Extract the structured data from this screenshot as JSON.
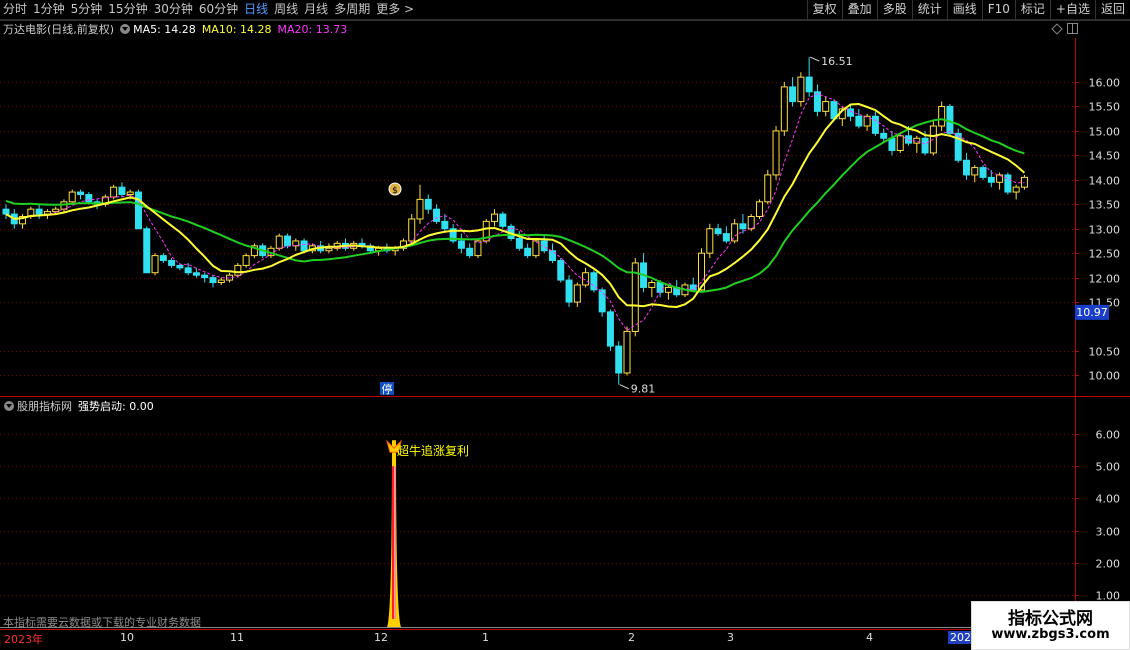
{
  "toolbar": {
    "periods": [
      {
        "label": "分时",
        "active": false
      },
      {
        "label": "1分钟",
        "active": false
      },
      {
        "label": "5分钟",
        "active": false
      },
      {
        "label": "15分钟",
        "active": false
      },
      {
        "label": "30分钟",
        "active": false
      },
      {
        "label": "60分钟",
        "active": false
      },
      {
        "label": "日线",
        "active": true
      },
      {
        "label": "周线",
        "active": false
      },
      {
        "label": "月线",
        "active": false
      },
      {
        "label": "多周期",
        "active": false
      },
      {
        "label": "更多 >",
        "active": false
      }
    ],
    "buttons": [
      "复权",
      "叠加",
      "多股",
      "统计",
      "画线",
      "F10",
      "标记",
      "+自选",
      "返回"
    ]
  },
  "main_chart": {
    "stock_title": "万达电影(日线,前复权)",
    "ma5": "MA5: 14.28",
    "ma10": "MA10: 14.28",
    "ma20": "MA20: 13.73",
    "max_label": "16.51",
    "min_label": "9.81",
    "current_price": "10.97",
    "limit_marker": "停",
    "money_icon_text": "$",
    "y_labels": [
      "16.00",
      "15.50",
      "15.00",
      "14.50",
      "14.00",
      "13.50",
      "13.00",
      "12.50",
      "12.00",
      "11.50",
      "10.50",
      "10.00"
    ]
  },
  "sub_chart": {
    "indicator_name": "股朋指标网",
    "indicator_line": "强势启动: 0.00",
    "signal_text": "超牛追涨复利",
    "y_labels": [
      "6.00",
      "5.00",
      "4.00",
      "3.00",
      "2.00",
      "1.00"
    ],
    "notice": "本指标需要云数据或下载的专业财务数据"
  },
  "date_axis": [
    "2023年",
    "10",
    "11",
    "12",
    "1",
    "2",
    "3",
    "4",
    "2024"
  ],
  "watermark": {
    "title": "指标公式网",
    "url": "www.zbgs3.com"
  },
  "colors": {
    "up": "#ffe040",
    "down": "#30e0f0",
    "ma_yellow": "#ffff33",
    "ma_green": "#20d020",
    "ma_magenta": "#ff33ff",
    "grid": "#7a0000",
    "axis": "#c00000"
  },
  "chart_data": {
    "type": "candlestick",
    "ylim": [
      9.6,
      16.9
    ],
    "candles": [
      [
        13.4,
        13.5,
        13.2,
        13.3
      ],
      [
        13.3,
        13.4,
        13.0,
        13.1
      ],
      [
        13.1,
        13.3,
        13.0,
        13.25
      ],
      [
        13.25,
        13.45,
        13.2,
        13.4
      ],
      [
        13.4,
        13.5,
        13.2,
        13.3
      ],
      [
        13.3,
        13.4,
        13.2,
        13.35
      ],
      [
        13.35,
        13.45,
        13.3,
        13.4
      ],
      [
        13.4,
        13.6,
        13.35,
        13.55
      ],
      [
        13.55,
        13.8,
        13.5,
        13.75
      ],
      [
        13.75,
        13.8,
        13.6,
        13.7
      ],
      [
        13.7,
        13.75,
        13.5,
        13.55
      ],
      [
        13.55,
        13.6,
        13.4,
        13.5
      ],
      [
        13.5,
        13.7,
        13.45,
        13.65
      ],
      [
        13.65,
        13.9,
        13.6,
        13.85
      ],
      [
        13.85,
        13.95,
        13.65,
        13.7
      ],
      [
        13.7,
        13.8,
        13.6,
        13.75
      ],
      [
        13.75,
        13.8,
        13.0,
        13.0
      ],
      [
        13.0,
        13.05,
        12.1,
        12.1
      ],
      [
        12.1,
        12.5,
        12.05,
        12.45
      ],
      [
        12.45,
        12.5,
        12.3,
        12.35
      ],
      [
        12.35,
        12.4,
        12.2,
        12.25
      ],
      [
        12.25,
        12.3,
        12.15,
        12.2
      ],
      [
        12.2,
        12.3,
        12.05,
        12.1
      ],
      [
        12.1,
        12.2,
        12.0,
        12.05
      ],
      [
        12.05,
        12.1,
        11.9,
        12.0
      ],
      [
        12.0,
        12.05,
        11.8,
        11.9
      ],
      [
        11.9,
        12.0,
        11.85,
        11.95
      ],
      [
        11.95,
        12.1,
        11.9,
        12.05
      ],
      [
        12.05,
        12.3,
        12.0,
        12.25
      ],
      [
        12.25,
        12.5,
        12.2,
        12.45
      ],
      [
        12.45,
        12.7,
        12.4,
        12.65
      ],
      [
        12.65,
        12.7,
        12.4,
        12.45
      ],
      [
        12.45,
        12.65,
        12.4,
        12.6
      ],
      [
        12.6,
        12.9,
        12.55,
        12.85
      ],
      [
        12.85,
        12.9,
        12.6,
        12.65
      ],
      [
        12.65,
        12.8,
        12.55,
        12.75
      ],
      [
        12.75,
        12.8,
        12.5,
        12.55
      ],
      [
        12.55,
        12.7,
        12.5,
        12.65
      ],
      [
        12.65,
        12.75,
        12.5,
        12.55
      ],
      [
        12.55,
        12.7,
        12.5,
        12.6
      ],
      [
        12.6,
        12.75,
        12.55,
        12.7
      ],
      [
        12.7,
        12.8,
        12.55,
        12.6
      ],
      [
        12.6,
        12.75,
        12.55,
        12.7
      ],
      [
        12.7,
        12.8,
        12.6,
        12.65
      ],
      [
        12.65,
        12.7,
        12.5,
        12.55
      ],
      [
        12.55,
        12.65,
        12.45,
        12.6
      ],
      [
        12.6,
        12.7,
        12.5,
        12.55
      ],
      [
        12.55,
        12.65,
        12.45,
        12.6
      ],
      [
        12.6,
        12.8,
        12.55,
        12.75
      ],
      [
        12.75,
        13.3,
        12.7,
        13.2
      ],
      [
        13.2,
        13.9,
        13.1,
        13.6
      ],
      [
        13.6,
        13.7,
        13.3,
        13.4
      ],
      [
        13.4,
        13.5,
        13.1,
        13.15
      ],
      [
        13.15,
        13.3,
        12.95,
        13.0
      ],
      [
        13.0,
        13.1,
        12.7,
        12.75
      ],
      [
        12.75,
        12.9,
        12.5,
        12.6
      ],
      [
        12.6,
        12.7,
        12.4,
        12.45
      ],
      [
        12.45,
        12.8,
        12.4,
        12.75
      ],
      [
        12.75,
        13.2,
        12.7,
        13.15
      ],
      [
        13.15,
        13.4,
        13.05,
        13.3
      ],
      [
        13.3,
        13.35,
        13.0,
        13.05
      ],
      [
        13.05,
        13.1,
        12.75,
        12.8
      ],
      [
        12.8,
        12.95,
        12.55,
        12.6
      ],
      [
        12.6,
        12.7,
        12.4,
        12.45
      ],
      [
        12.45,
        12.8,
        12.4,
        12.75
      ],
      [
        12.75,
        12.85,
        12.5,
        12.55
      ],
      [
        12.55,
        12.7,
        12.3,
        12.35
      ],
      [
        12.35,
        12.4,
        11.9,
        11.95
      ],
      [
        11.95,
        12.05,
        11.4,
        11.5
      ],
      [
        11.5,
        11.9,
        11.4,
        11.85
      ],
      [
        11.85,
        12.2,
        11.8,
        12.1
      ],
      [
        12.1,
        12.15,
        11.7,
        11.75
      ],
      [
        11.75,
        11.8,
        11.2,
        11.3
      ],
      [
        11.3,
        11.35,
        10.5,
        10.6
      ],
      [
        10.6,
        10.7,
        9.81,
        10.05
      ],
      [
        10.05,
        11.0,
        10.0,
        10.9
      ],
      [
        10.9,
        12.4,
        10.8,
        12.3
      ],
      [
        12.3,
        12.5,
        11.7,
        11.8
      ],
      [
        11.8,
        11.95,
        11.6,
        11.9
      ],
      [
        11.9,
        11.95,
        11.6,
        11.7
      ],
      [
        11.7,
        11.85,
        11.55,
        11.8
      ],
      [
        11.8,
        11.95,
        11.6,
        11.65
      ],
      [
        11.65,
        11.9,
        11.6,
        11.85
      ],
      [
        11.85,
        12.0,
        11.7,
        11.75
      ],
      [
        11.75,
        12.6,
        11.7,
        12.5
      ],
      [
        12.5,
        13.1,
        12.4,
        13.0
      ],
      [
        13.0,
        13.1,
        12.85,
        12.9
      ],
      [
        12.9,
        13.05,
        12.7,
        12.75
      ],
      [
        12.75,
        13.2,
        12.7,
        13.1
      ],
      [
        13.1,
        13.3,
        12.9,
        13.0
      ],
      [
        13.0,
        13.3,
        12.95,
        13.25
      ],
      [
        13.25,
        13.6,
        13.2,
        13.55
      ],
      [
        13.55,
        14.2,
        13.5,
        14.1
      ],
      [
        14.1,
        15.1,
        14.0,
        15.0
      ],
      [
        15.0,
        16.0,
        14.9,
        15.9
      ],
      [
        15.9,
        16.1,
        15.5,
        15.6
      ],
      [
        15.6,
        16.2,
        15.5,
        16.1
      ],
      [
        16.1,
        16.51,
        15.7,
        15.8
      ],
      [
        15.8,
        15.95,
        15.3,
        15.4
      ],
      [
        15.4,
        15.7,
        15.3,
        15.6
      ],
      [
        15.6,
        15.65,
        15.2,
        15.25
      ],
      [
        15.25,
        15.5,
        15.1,
        15.45
      ],
      [
        15.45,
        15.55,
        15.2,
        15.3
      ],
      [
        15.3,
        15.45,
        15.05,
        15.1
      ],
      [
        15.1,
        15.35,
        15.0,
        15.3
      ],
      [
        15.3,
        15.4,
        14.9,
        14.95
      ],
      [
        14.95,
        15.05,
        14.75,
        14.85
      ],
      [
        14.85,
        15.0,
        14.5,
        14.6
      ],
      [
        14.6,
        14.95,
        14.55,
        14.9
      ],
      [
        14.9,
        15.1,
        14.7,
        14.75
      ],
      [
        14.75,
        14.9,
        14.55,
        14.85
      ],
      [
        14.85,
        15.0,
        14.5,
        14.55
      ],
      [
        14.55,
        15.2,
        14.5,
        15.1
      ],
      [
        15.1,
        15.6,
        15.0,
        15.5
      ],
      [
        15.5,
        15.55,
        14.9,
        14.95
      ],
      [
        14.95,
        15.05,
        14.35,
        14.4
      ],
      [
        14.4,
        14.55,
        14.0,
        14.1
      ],
      [
        14.1,
        14.3,
        13.95,
        14.25
      ],
      [
        14.25,
        14.3,
        14.0,
        14.05
      ],
      [
        14.05,
        14.2,
        13.85,
        13.95
      ],
      [
        13.95,
        14.15,
        13.8,
        14.1
      ],
      [
        14.1,
        14.15,
        13.7,
        13.75
      ],
      [
        13.75,
        13.9,
        13.6,
        13.85
      ],
      [
        13.85,
        14.1,
        13.8,
        14.05
      ]
    ],
    "signal_index": 49,
    "sub_ylim": [
      0,
      6.5
    ],
    "signal_value": 5.0
  }
}
